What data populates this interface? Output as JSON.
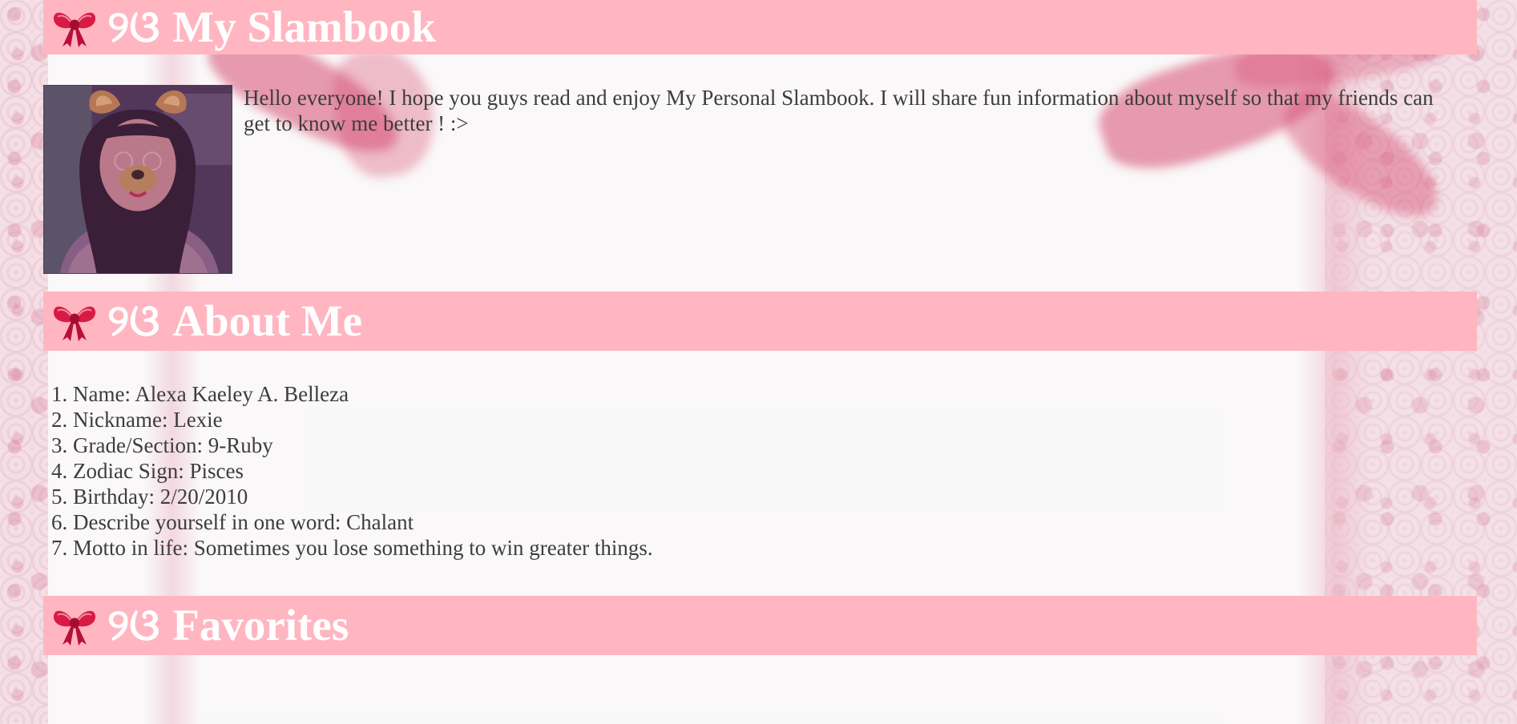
{
  "colors": {
    "header_bg": "#ffb6c1",
    "header_text": "#ffffff",
    "body_text": "#3d3d3d",
    "bow_red": "#c8163c"
  },
  "icons": {
    "section_icon": "ribbon-bow-icon"
  },
  "sections": {
    "slambook": {
      "prefix": "୨ଓ",
      "title": "My Slambook"
    },
    "about": {
      "prefix": "୨ଓ",
      "title": "About Me"
    },
    "favorites": {
      "prefix": "୨ଓ",
      "title": "Favorites"
    }
  },
  "intro": {
    "text": "Hello everyone! I hope you guys read and enjoy My Personal Slambook. I will share fun information about myself so that my friends can get to know me better ! :>"
  },
  "about_items": [
    "1. Name: Alexa Kaeley A. Belleza",
    "2. Nickname: Lexie",
    "3. Grade/Section: 9-Ruby",
    "4. Zodiac Sign: Pisces",
    "5. Birthday: 2/20/2010",
    "6. Describe yourself in one word: Chalant",
    "7. Motto in life: Sometimes you lose something to win greater things."
  ]
}
